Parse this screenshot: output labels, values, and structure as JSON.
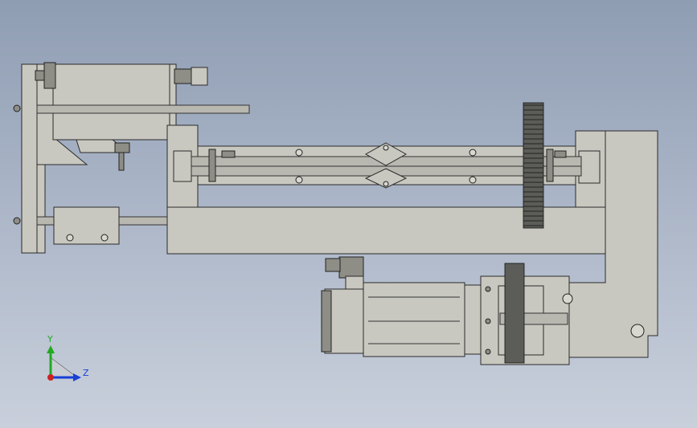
{
  "triad": {
    "y_label": "Y",
    "z_label": "Z",
    "colors": {
      "y": "#22aa22",
      "z": "#1a3fd6",
      "origin": "#cc2222"
    }
  },
  "colors": {
    "background_top": "#8f9db3",
    "background_bottom": "#c9d0dc",
    "part": "#c9c8c0",
    "gear": "#5c5c58"
  }
}
